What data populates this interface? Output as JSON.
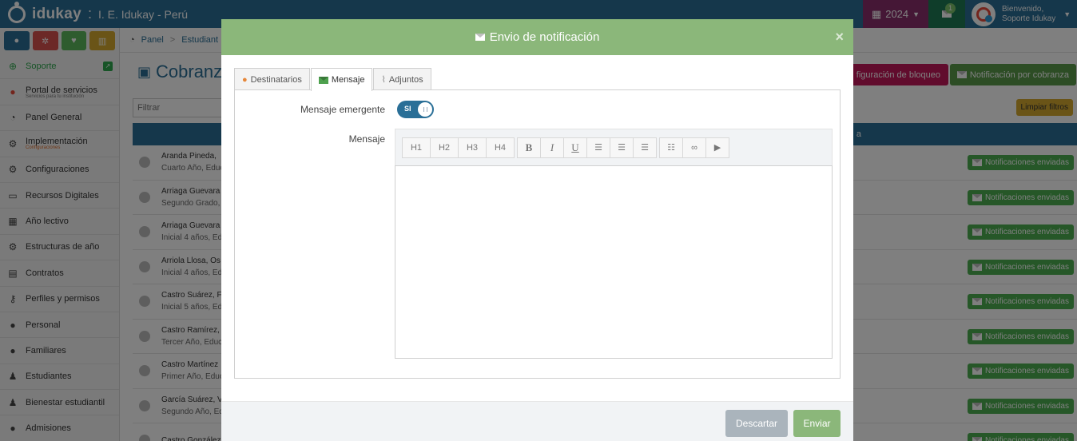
{
  "app": {
    "logo_text": "idukay",
    "separator": ":",
    "school_name": "I. E. Idukay - Perú",
    "year": "2024",
    "mail_count": "1",
    "welcome": "Bienvenido,",
    "user_name": "Soporte Idukay"
  },
  "sidebar": {
    "quick_colors": [
      "#2a6f97",
      "#d9534f",
      "#5cb85c",
      "#d4a92e"
    ],
    "items": [
      {
        "label": "Soporte",
        "icon": "support-icon",
        "glyph": "⊕",
        "sub": ""
      },
      {
        "label": "Portal de servicios",
        "icon": "portal-icon",
        "glyph": "●",
        "sub": "Servicios para tu institución"
      },
      {
        "label": "Panel General",
        "icon": "dashboard-icon",
        "glyph": "◔",
        "sub": ""
      },
      {
        "label": "Implementación",
        "icon": "cogs-icon",
        "glyph": "⚙",
        "sub": "Configuraciones"
      },
      {
        "label": "Configuraciones",
        "icon": "cogs-icon",
        "glyph": "⚙",
        "sub": ""
      },
      {
        "label": "Recursos Digitales",
        "icon": "laptop-icon",
        "glyph": "▭",
        "sub": ""
      },
      {
        "label": "Año lectivo",
        "icon": "calendar-icon",
        "glyph": "▦",
        "sub": ""
      },
      {
        "label": "Estructuras de año",
        "icon": "gear-icon",
        "glyph": "⚙",
        "sub": ""
      },
      {
        "label": "Contratos",
        "icon": "document-icon",
        "glyph": "▤",
        "sub": ""
      },
      {
        "label": "Perfiles y permisos",
        "icon": "key-icon",
        "glyph": "⚷",
        "sub": ""
      },
      {
        "label": "Personal",
        "icon": "user-icon",
        "glyph": "●",
        "sub": ""
      },
      {
        "label": "Familiares",
        "icon": "user-icon",
        "glyph": "●",
        "sub": ""
      },
      {
        "label": "Estudiantes",
        "icon": "child-icon",
        "glyph": "♟",
        "sub": ""
      },
      {
        "label": "Bienestar estudiantil",
        "icon": "wellbeing-icon",
        "glyph": "♟",
        "sub": ""
      },
      {
        "label": "Admisiones",
        "icon": "users-icon",
        "glyph": "●",
        "sub": ""
      }
    ]
  },
  "main": {
    "breadcrumb_panel": "Panel",
    "breadcrumb_sep": ">",
    "breadcrumb_current": "Estudiant",
    "page_title": "Cobranza",
    "filter_placeholder": "Filtrar",
    "btn_config": "figuración de bloqueo",
    "btn_notification": "Notificación por cobranza",
    "btn_clear": "Limpiar filtros",
    "table_header": "a",
    "rows": [
      {
        "name": "Aranda Pineda,",
        "sub": "Cuarto Año, Educ",
        "badge": "Notificaciones enviadas"
      },
      {
        "name": "Arriaga Guevara",
        "sub": "Segundo Grado,",
        "badge": "Notificaciones enviadas"
      },
      {
        "name": "Arriaga Guevara",
        "sub": "Inicial 4 años, Edu",
        "badge": "Notificaciones enviadas"
      },
      {
        "name": "Arriola Llosa, Os",
        "sub": "Inicial 4 años, Edu",
        "badge": "Notificaciones enviadas"
      },
      {
        "name": "Castro Suárez, F",
        "sub": "Inicial 5 años, Edu",
        "badge": "Notificaciones enviadas"
      },
      {
        "name": "Castro Ramírez,",
        "sub": "Tercer Año, Educ",
        "badge": "Notificaciones enviadas"
      },
      {
        "name": "Castro Martínez",
        "sub": "Primer Año, Educ",
        "badge": "Notificaciones enviadas"
      },
      {
        "name": "García Suárez, V",
        "sub": "Segundo Año, Ed",
        "badge": "Notificaciones enviadas"
      },
      {
        "name": "Castro González",
        "sub": "",
        "badge": "Notificaciones enviadas"
      }
    ]
  },
  "modal": {
    "title": "Envio de notificación",
    "close": "×",
    "tabs": [
      {
        "label": "Destinatarios",
        "active": false
      },
      {
        "label": "Mensaje",
        "active": true
      },
      {
        "label": "Adjuntos",
        "active": false
      }
    ],
    "popup_label": "Mensaje emergente",
    "toggle_value": "SI",
    "toggle_on": true,
    "message_label": "Mensaje",
    "toolbar": {
      "headings": [
        "H1",
        "H2",
        "H3",
        "H4"
      ],
      "bold": "B",
      "italic": "I",
      "underline": "U"
    },
    "discard": "Descartar",
    "send": "Enviar"
  }
}
